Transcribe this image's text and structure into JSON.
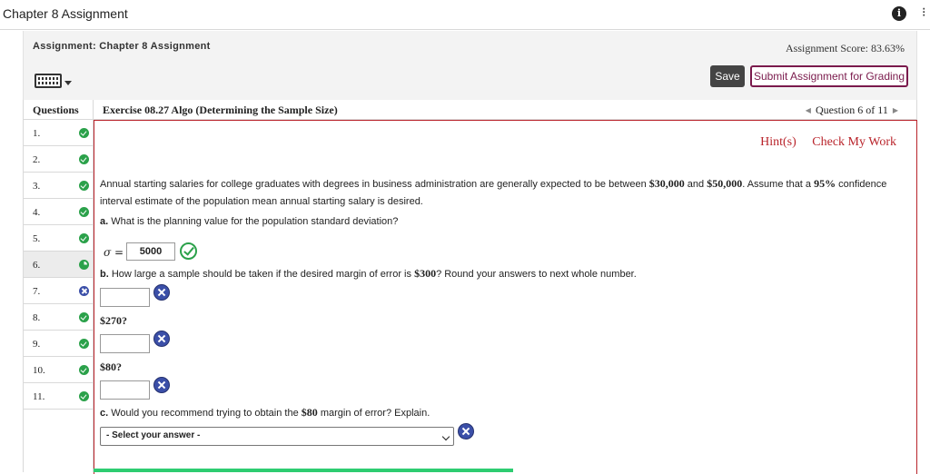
{
  "app": {
    "title": "Chapter 8 Assignment"
  },
  "header": {
    "assignment_title": "Assignment: Chapter 8 Assignment",
    "score": "Assignment Score: 83.63%",
    "save_label": "Save",
    "submit_label": "Submit Assignment for Grading"
  },
  "questions": {
    "header": "Questions",
    "items": [
      {
        "num": "1.",
        "status": "correct"
      },
      {
        "num": "2.",
        "status": "correct"
      },
      {
        "num": "3.",
        "status": "correct"
      },
      {
        "num": "4.",
        "status": "correct"
      },
      {
        "num": "5.",
        "status": "correct"
      },
      {
        "num": "6.",
        "status": "partial"
      },
      {
        "num": "7.",
        "status": "incorrect"
      },
      {
        "num": "8.",
        "status": "correct"
      },
      {
        "num": "9.",
        "status": "correct"
      },
      {
        "num": "10.",
        "status": "correct"
      },
      {
        "num": "11.",
        "status": "correct"
      }
    ]
  },
  "exercise": {
    "title": "Exercise 08.27 Algo (Determining the Sample Size)",
    "nav_text": "Question 6 of 11",
    "hint_label": "Hint(s)",
    "check_label": "Check My Work",
    "text_part1": "Annual starting salaries for college graduates with degrees in business administration are generally expected to be between ",
    "low_salary": "$30,000",
    "and_text": " and ",
    "high_salary": "$50,000",
    "text_part2": ". Assume that a ",
    "confidence": "95%",
    "text_part3": " confidence interval estimate of the population mean annual starting salary is desired.",
    "part_a_label": "a.",
    "part_a_text": " What is the planning value for the population standard deviation?",
    "sigma_label": "σ =",
    "sigma_value": "5000",
    "part_b_label": "b.",
    "part_b_text1": " How large a sample should be taken if the desired margin of error is ",
    "margin_300": "$300",
    "part_b_text2": "? Round your answers to next whole number.",
    "margin_270": "$270?",
    "margin_80": "$80?",
    "part_c_label": "c.",
    "part_c_text1": " Would you recommend trying to obtain the ",
    "margin_80c": "$80",
    "part_c_text2": " margin of error? Explain.",
    "select_placeholder": "- Select your answer -"
  },
  "colors": {
    "accent": "#7a1a4c",
    "error_border": "#b9242b",
    "correct": "#2ba14a",
    "incorrect": "#3b4fa8",
    "progress": "#2ecc71"
  }
}
